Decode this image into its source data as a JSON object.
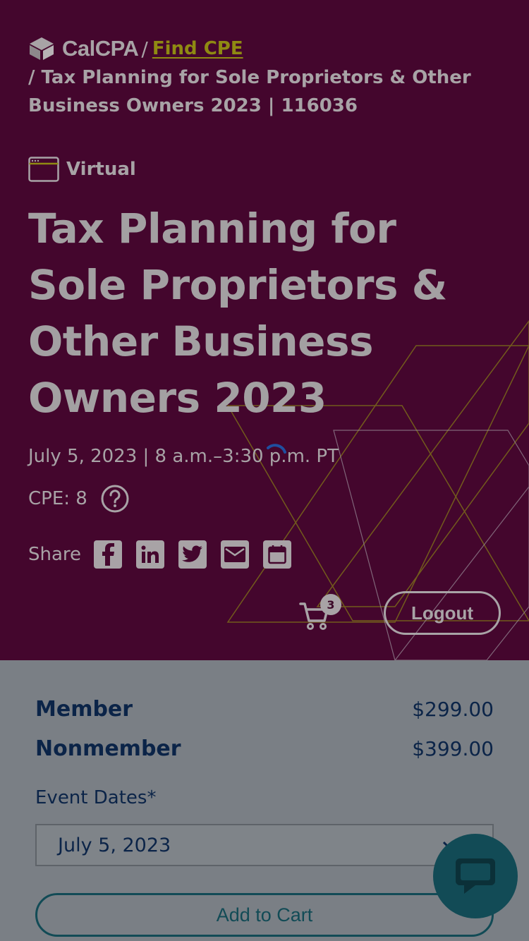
{
  "breadcrumb": {
    "brand": "CalCPA",
    "separator": "/",
    "link": "Find CPE",
    "current": "/ Tax Planning for Sole Proprietors & Other Business Owners 2023 | 116036"
  },
  "event": {
    "format": "Virtual",
    "title": "Tax Planning for Sole Proprietors & Other Business Owners 2023",
    "datetime": "July 5, 2023 | 8 a.m.–3:30 p.m. PT",
    "cpe": "CPE: 8",
    "share_label": "Share",
    "share_icons": [
      "facebook-icon",
      "linkedin-icon",
      "twitter-icon",
      "email-icon",
      "calendar-icon"
    ]
  },
  "header_actions": {
    "cart_count": "3",
    "logout": "Logout"
  },
  "pricing": {
    "rows": [
      {
        "name": "Member",
        "price": "$299.00"
      },
      {
        "name": "Nonmember",
        "price": "$399.00"
      }
    ],
    "dates_label": "Event Dates*",
    "selected_date": "July 5, 2023",
    "add_to_cart": "Add to Cart"
  },
  "colors": {
    "hero_bg": "#44062d",
    "accent_gold": "#8f8a12",
    "navy": "#0b2448",
    "teal": "#124b56"
  }
}
